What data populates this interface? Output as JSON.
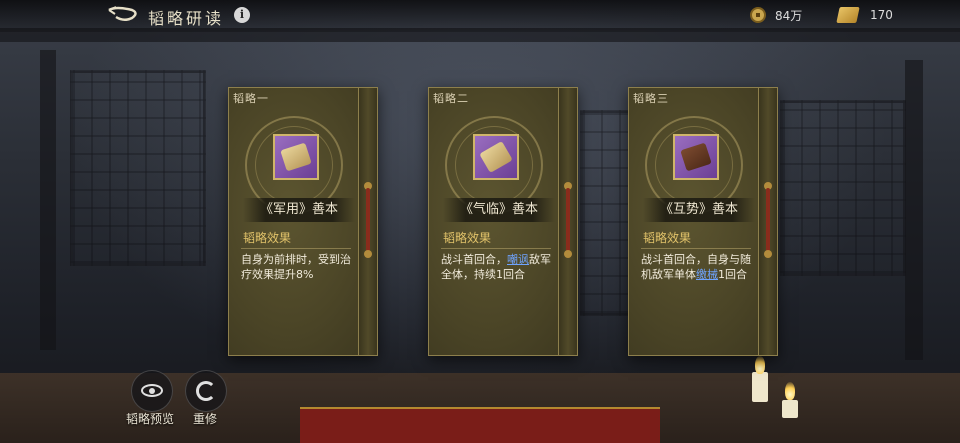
{
  "header": {
    "title": "韬略研读",
    "info_icon": "i"
  },
  "resources": [
    {
      "icon": "coin-icon",
      "value": "84万"
    },
    {
      "icon": "book-icon",
      "value": "170"
    }
  ],
  "cards": [
    {
      "tab": "韬略一",
      "item_icon": "scroll-icon",
      "name": "《军用》善本",
      "effect_label": "韬略效果",
      "effect": [
        {
          "t": "自身为前排时，受到治疗效果提升8%"
        }
      ]
    },
    {
      "tab": "韬略二",
      "item_icon": "scroll-icon",
      "name": "《气临》善本",
      "effect_label": "韬略效果",
      "effect": [
        {
          "t": "战斗首回合，"
        },
        {
          "t": "嘲讽",
          "kw": true
        },
        {
          "t": "敌军全体，持续1回合"
        }
      ]
    },
    {
      "tab": "韬略三",
      "item_icon": "scroll-icon",
      "name": "《互势》善本",
      "effect_label": "韬略效果",
      "effect": [
        {
          "t": "战斗首回合，自身与随机敌军单体"
        },
        {
          "t": "缴械",
          "kw": true
        },
        {
          "t": "1回合"
        }
      ]
    }
  ],
  "bottom_buttons": [
    {
      "label": "韬略预览",
      "icon": "eye-icon"
    },
    {
      "label": "重修",
      "icon": "refresh-icon"
    }
  ],
  "colors": {
    "keyword": "#6fa4ff",
    "effect_label": "#e2c36a",
    "card_bg": "#4a4426"
  }
}
